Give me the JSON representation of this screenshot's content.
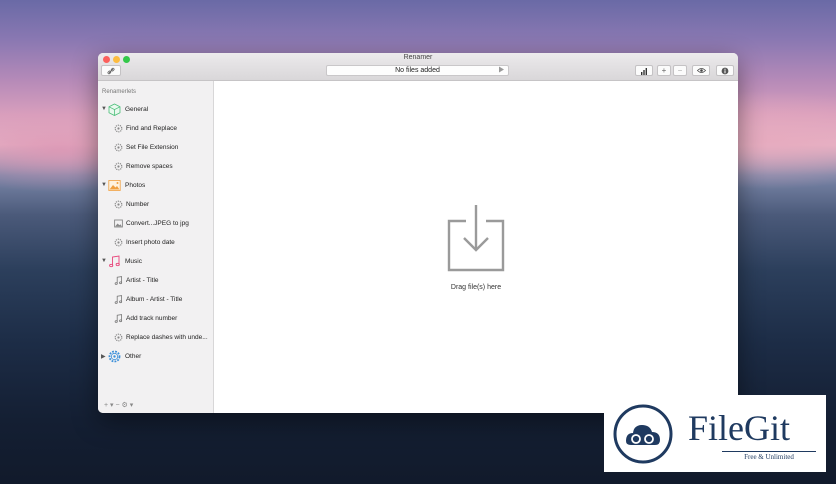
{
  "window": {
    "title": "Renamer"
  },
  "toolbar": {
    "status": "No files added",
    "add_label": "+",
    "remove_label": "−",
    "stats_icon": "bar-chart-icon",
    "info_icon": "info-icon",
    "eye_icon": "eye-icon",
    "link_icon": "link-icon",
    "play_icon": "play-icon"
  },
  "sidebar": {
    "header": "Renamerlets",
    "groups": [
      {
        "label": "General",
        "icon": "cube-icon",
        "items": [
          {
            "label": "Find and Replace",
            "icon": "gear-icon"
          },
          {
            "label": "Set File Extension",
            "icon": "gear-icon"
          },
          {
            "label": "Remove spaces",
            "icon": "gear-icon"
          }
        ]
      },
      {
        "label": "Photos",
        "icon": "photo-icon",
        "items": [
          {
            "label": "Number",
            "icon": "gear-icon"
          },
          {
            "label": "Convert...JPEG to jpg",
            "icon": "photo-icon"
          },
          {
            "label": "Insert photo date",
            "icon": "gear-icon"
          }
        ]
      },
      {
        "label": "Music",
        "icon": "music-note-icon",
        "items": [
          {
            "label": "Artist - Title",
            "icon": "music-note-icon"
          },
          {
            "label": "Album - Artist - Title",
            "icon": "music-note-icon"
          },
          {
            "label": "Add track number",
            "icon": "music-note-icon"
          },
          {
            "label": "Replace dashes with unde...",
            "icon": "gear-icon"
          }
        ]
      },
      {
        "label": "Other",
        "icon": "gear-icon",
        "items": []
      }
    ],
    "footer": "+ ▾  −  ⚙ ▾"
  },
  "main": {
    "drop_label": "Drag file(s) here",
    "drop_icon": "download-icon"
  },
  "watermark": {
    "name": "FileGit",
    "tagline": "Free & Unlimited"
  },
  "colors": {
    "close": "#fc605c",
    "minimize": "#fdbc40",
    "maximize": "#34c84a",
    "brand": "#1f3a60"
  }
}
